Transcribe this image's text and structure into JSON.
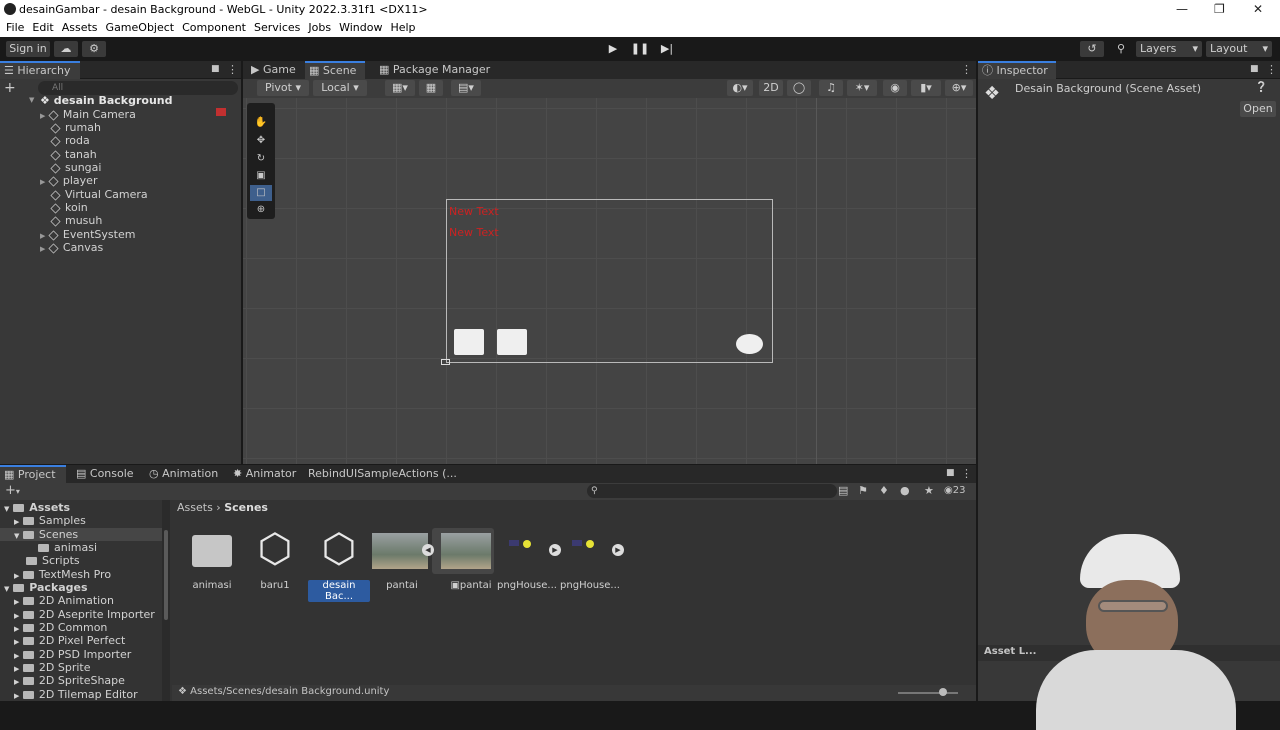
{
  "window": {
    "title": "desainGambar - desain Background - WebGL - Unity 2022.3.31f1 <DX11>"
  },
  "menu": [
    "File",
    "Edit",
    "Assets",
    "GameObject",
    "Component",
    "Services",
    "Jobs",
    "Window",
    "Help"
  ],
  "toolbar": {
    "sign_in": "Sign in",
    "layers": "Layers",
    "layout": "Layout"
  },
  "hierarchy": {
    "tab": "Hierarchy",
    "search_placeholder": "All",
    "scene": "desain Background",
    "items": [
      "Main Camera",
      "rumah",
      "roda",
      "tanah",
      "sungai",
      "player",
      "Virtual Camera",
      "koin",
      "musuh",
      "EventSystem",
      "Canvas"
    ]
  },
  "center_tabs": [
    "Game",
    "Scene",
    "Package Manager"
  ],
  "scene_toolbar": {
    "pivot": "Pivot",
    "local": "Local",
    "mode2d": "2D"
  },
  "scene_view": {
    "text1": "New Text",
    "text2": "New Text"
  },
  "inspector": {
    "tab": "Inspector",
    "title": "Desain Background (Scene Asset)",
    "open": "Open",
    "asset_label": "Asset L..."
  },
  "bottom_tabs": [
    "Project",
    "Console",
    "Animation",
    "Animator",
    "RebindUISampleActions (..."
  ],
  "project": {
    "hidden_count": "23",
    "tree": [
      "Assets",
      "Samples",
      "Scenes",
      "animasi",
      "Scripts",
      "TextMesh Pro",
      "Packages",
      "2D Animation",
      "2D Aseprite Importer",
      "2D Common",
      "2D Pixel Perfect",
      "2D PSD Importer",
      "2D Sprite",
      "2D SpriteShape",
      "2D Tilemap Editor"
    ],
    "breadcrumb": [
      "Assets",
      "Scenes"
    ],
    "assets": [
      "animasi",
      "baru1",
      "desain Bac...",
      "pantai",
      "pantai",
      "pngHouse...",
      "pngHouse..."
    ],
    "status_path": "Assets/Scenes/desain Background.unity"
  }
}
